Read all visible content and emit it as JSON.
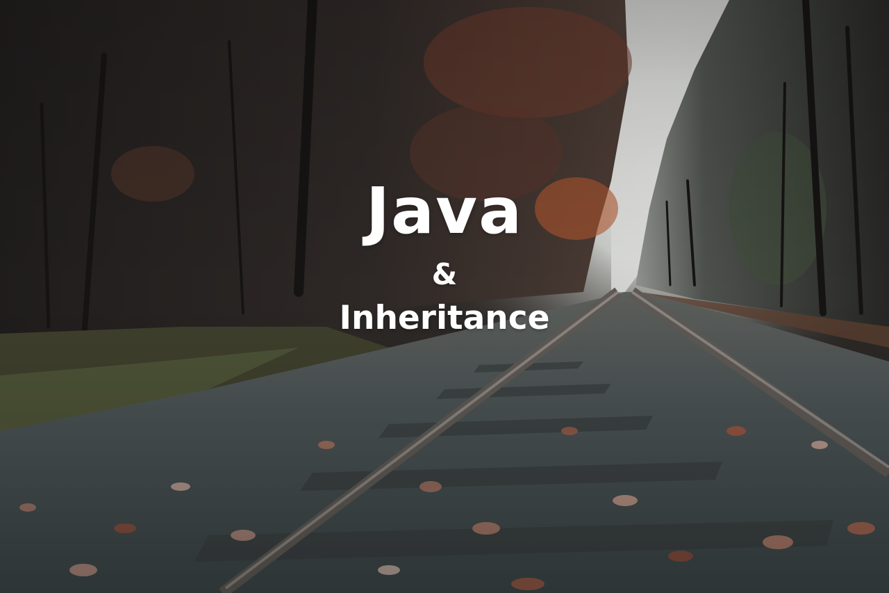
{
  "title": {
    "main": "Java",
    "connector": "&",
    "subtitle": "Inheritance"
  },
  "colors": {
    "text": "#ffffff",
    "sky": "#e6e7e6",
    "forest_dark": "#2b2624",
    "foliage_rust": "#8a4a36",
    "gravel": "#4a5658",
    "rail": "#5b5752"
  },
  "scene": {
    "description_icons": [
      "forest-icon",
      "railway-track-icon",
      "fallen-leaves-icon"
    ]
  }
}
